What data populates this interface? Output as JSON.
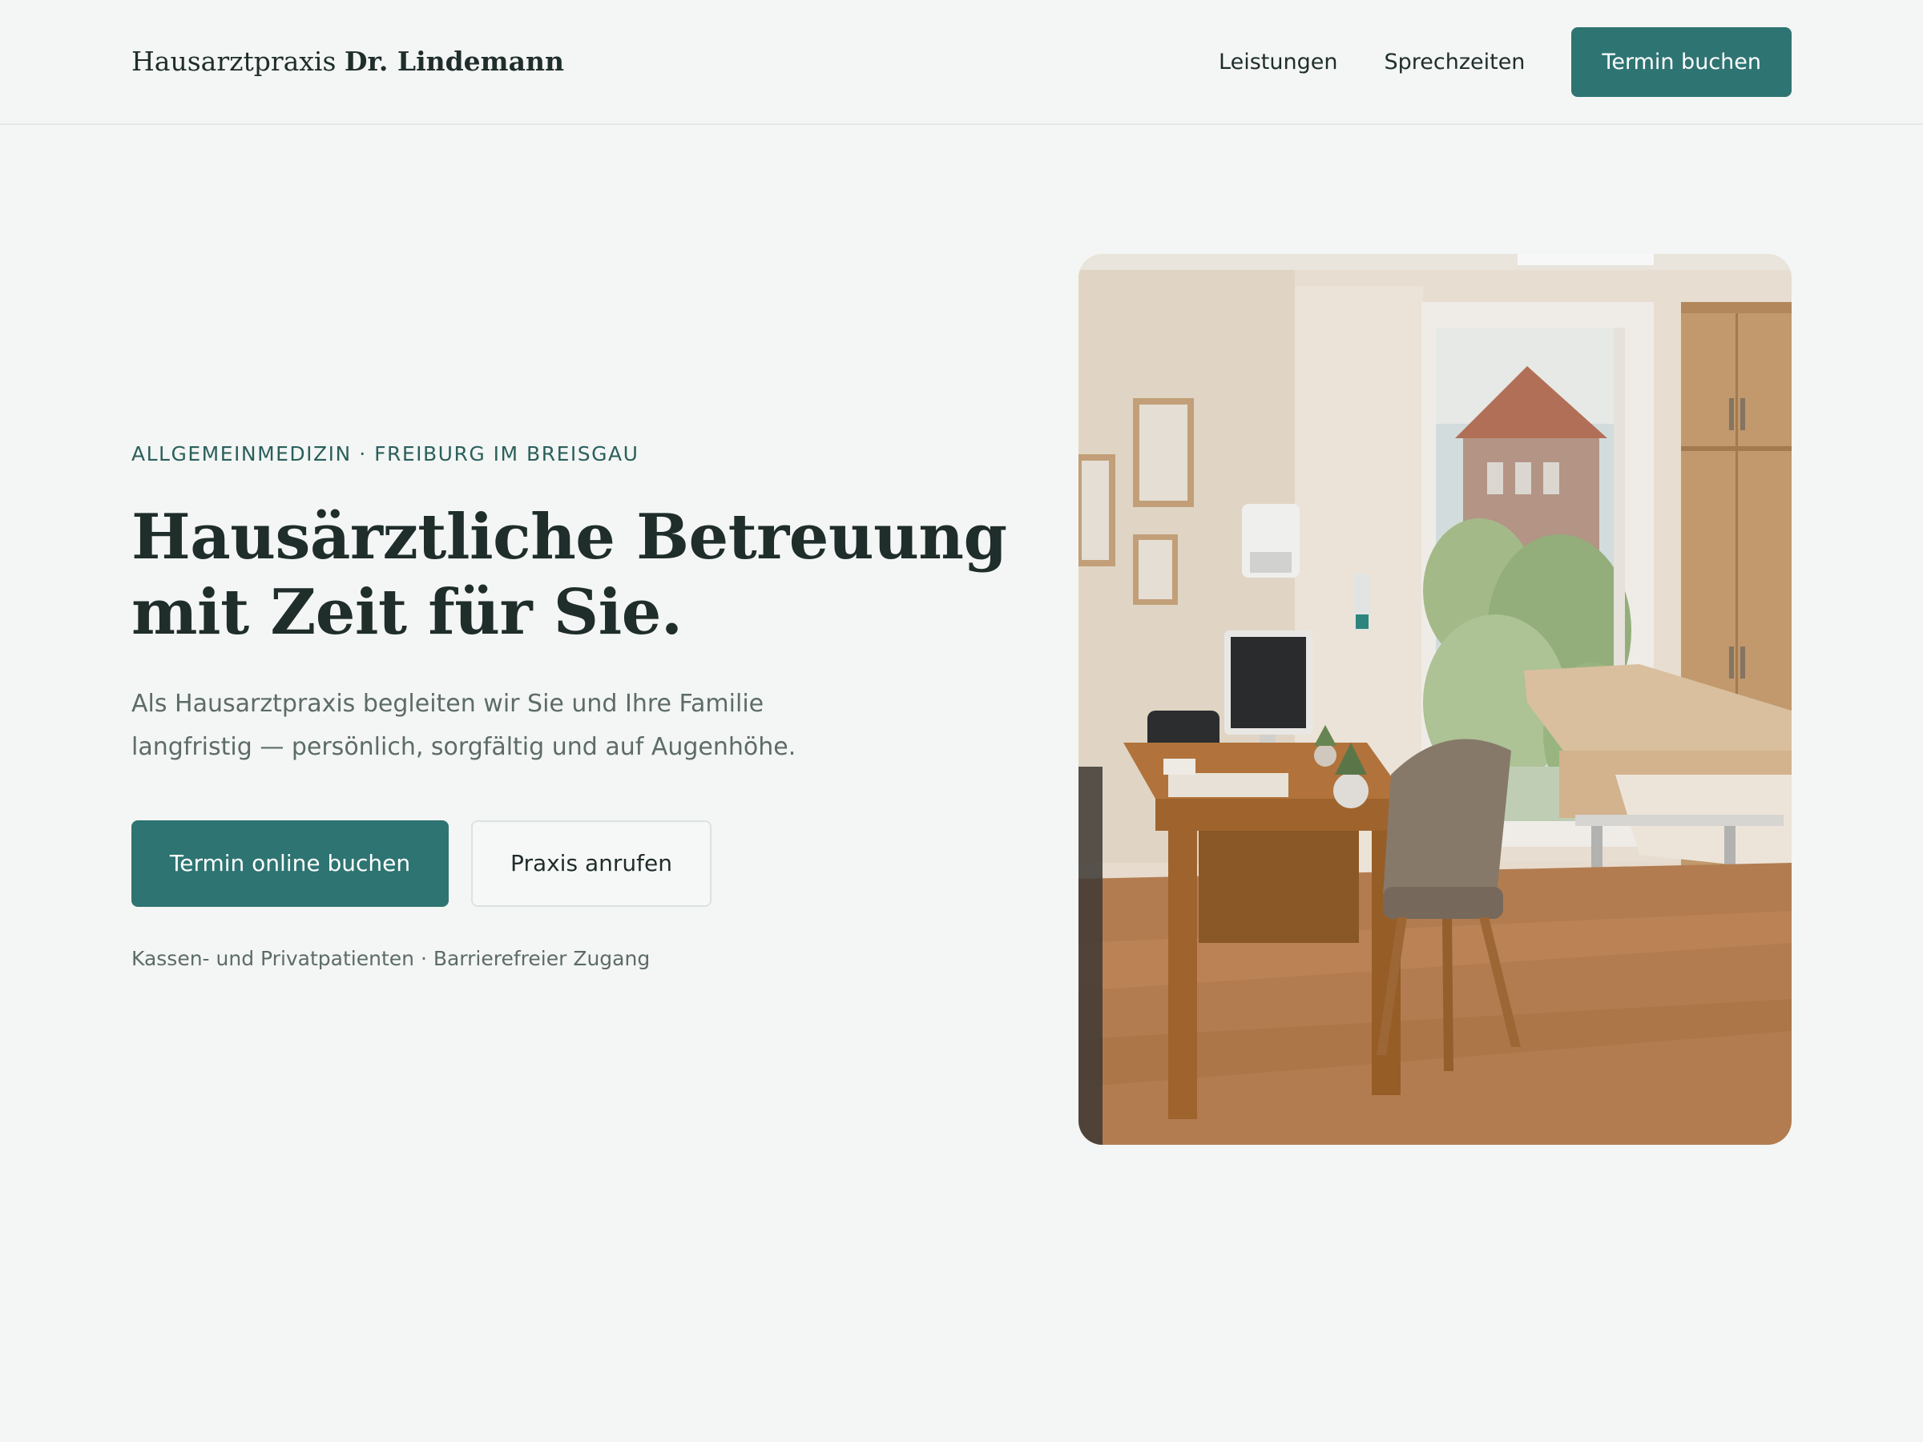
{
  "header": {
    "brand_prefix": "Hausarztpraxis",
    "brand_name": "Dr. Lindemann",
    "nav": [
      {
        "label": "Leistungen"
      },
      {
        "label": "Sprechzeiten"
      }
    ],
    "cta_label": "Termin buchen"
  },
  "hero": {
    "eyebrow": "ALLGEMEINMEDIZIN · FREIBURG IM BREISGAU",
    "title_lines": [
      "Hausärztliche Betreuung",
      "mit Zeit für Sie."
    ],
    "lead_lines": [
      "Als Hausarztpraxis begleiten wir Sie und Ihre Familie",
      "langfristig — persönlich, sorgfältig und auf Augenhöhe."
    ],
    "primary_button": "Termin online buchen",
    "secondary_button": "Praxis anrufen",
    "trust_line": "Kassen- und Privatpatienten · Barrierefreier Zugang"
  },
  "colors": {
    "accent": "#2e7472",
    "background": "#f3f6f4",
    "text": "#1f2d2b",
    "muted": "#5d6b69"
  }
}
